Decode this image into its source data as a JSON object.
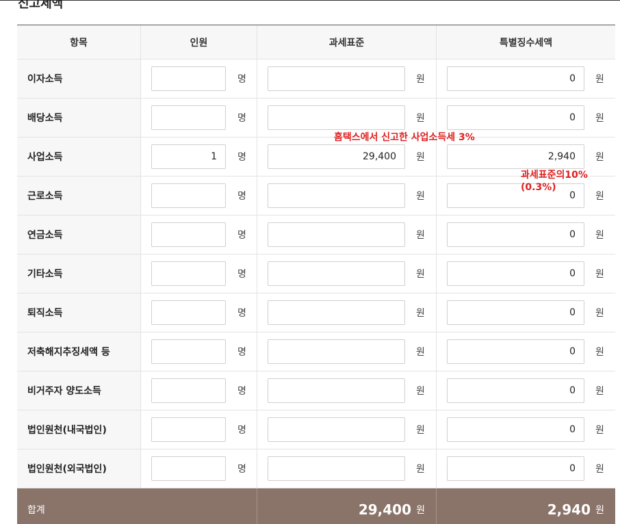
{
  "section_title": "신고세액",
  "headers": [
    "항목",
    "인원",
    "과세표준",
    "특별징수세액"
  ],
  "units": {
    "person": "명",
    "won": "원"
  },
  "rows": [
    {
      "label": "이자소득",
      "persons": "",
      "tax_base": "",
      "special_tax": "0"
    },
    {
      "label": "배당소득",
      "persons": "",
      "tax_base": "",
      "special_tax": "0"
    },
    {
      "label": "사업소득",
      "persons": "1",
      "tax_base": "29,400",
      "special_tax": "2,940"
    },
    {
      "label": "근로소득",
      "persons": "",
      "tax_base": "",
      "special_tax": "0"
    },
    {
      "label": "연금소득",
      "persons": "",
      "tax_base": "",
      "special_tax": "0"
    },
    {
      "label": "기타소득",
      "persons": "",
      "tax_base": "",
      "special_tax": "0"
    },
    {
      "label": "퇴직소득",
      "persons": "",
      "tax_base": "",
      "special_tax": "0"
    },
    {
      "label": "저축해지추징세액 등",
      "persons": "",
      "tax_base": "",
      "special_tax": "0"
    },
    {
      "label": "비거주자 양도소득",
      "persons": "",
      "tax_base": "",
      "special_tax": "0"
    },
    {
      "label": "법인원천(내국법인)",
      "persons": "",
      "tax_base": "",
      "special_tax": "0"
    },
    {
      "label": "법인원천(외국법인)",
      "persons": "",
      "tax_base": "",
      "special_tax": "0"
    }
  ],
  "total": {
    "label": "합계",
    "tax_base": "29,400",
    "special_tax": "2,940"
  },
  "annotations": {
    "business_note": "홈택스에서 신고한 사업소득세 3%",
    "ratio_line1": "과세표준의10%",
    "ratio_line2": "(0.3%)"
  },
  "colors": {
    "total_bg": "#8a7369",
    "annotation": "#e02020"
  }
}
